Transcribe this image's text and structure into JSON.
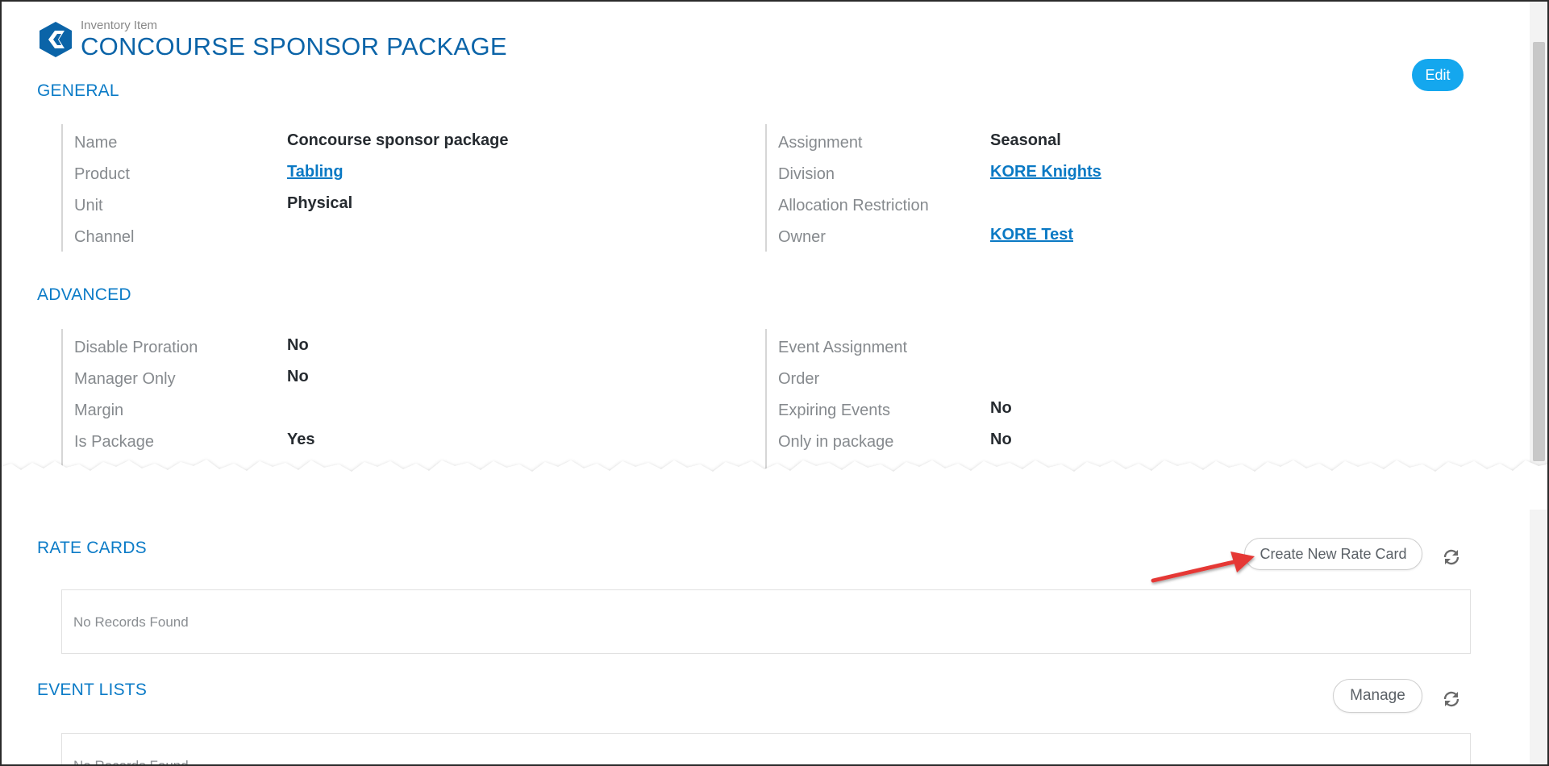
{
  "header": {
    "subtitle": "Inventory Item",
    "title": "CONCOURSE SPONSOR PACKAGE",
    "logo_icon": "kore-hexagon-logo-icon"
  },
  "actions": {
    "edit_label": "Edit"
  },
  "general": {
    "title": "GENERAL",
    "left": [
      {
        "label": "Name",
        "value": "Concourse sponsor package",
        "link": false
      },
      {
        "label": "Product",
        "value": "Tabling",
        "link": true
      },
      {
        "label": "Unit",
        "value": "Physical",
        "link": false
      },
      {
        "label": "Channel",
        "value": "",
        "link": false
      }
    ],
    "right": [
      {
        "label": "Assignment",
        "value": "Seasonal",
        "link": false
      },
      {
        "label": "Division",
        "value": "KORE Knights",
        "link": true
      },
      {
        "label": "Allocation Restriction",
        "value": "",
        "link": false
      },
      {
        "label": "Owner",
        "value": "KORE Test",
        "link": true
      }
    ]
  },
  "advanced": {
    "title": "ADVANCED",
    "left": [
      {
        "label": "Disable Proration",
        "value": "No"
      },
      {
        "label": "Manager Only",
        "value": "No"
      },
      {
        "label": "Margin",
        "value": ""
      },
      {
        "label": "Is Package",
        "value": "Yes"
      }
    ],
    "right": [
      {
        "label": "Event Assignment",
        "value": ""
      },
      {
        "label": "Order",
        "value": ""
      },
      {
        "label": "Expiring Events",
        "value": "No"
      },
      {
        "label": "Only in package",
        "value": "No"
      }
    ]
  },
  "rate_cards": {
    "title": "RATE CARDS",
    "create_label": "Create New Rate Card",
    "refresh_icon": "refresh-icon",
    "empty_text": "No Records Found"
  },
  "event_lists": {
    "title": "EVENT LISTS",
    "manage_label": "Manage",
    "refresh_icon": "refresh-icon",
    "empty_text": "No Records Found"
  },
  "colors": {
    "brand_blue": "#0b64a8",
    "section_blue": "#0b7bc7",
    "link_blue": "#0a79c4",
    "edit_button": "#14a7ee",
    "annotation_arrow": "#e53935"
  }
}
